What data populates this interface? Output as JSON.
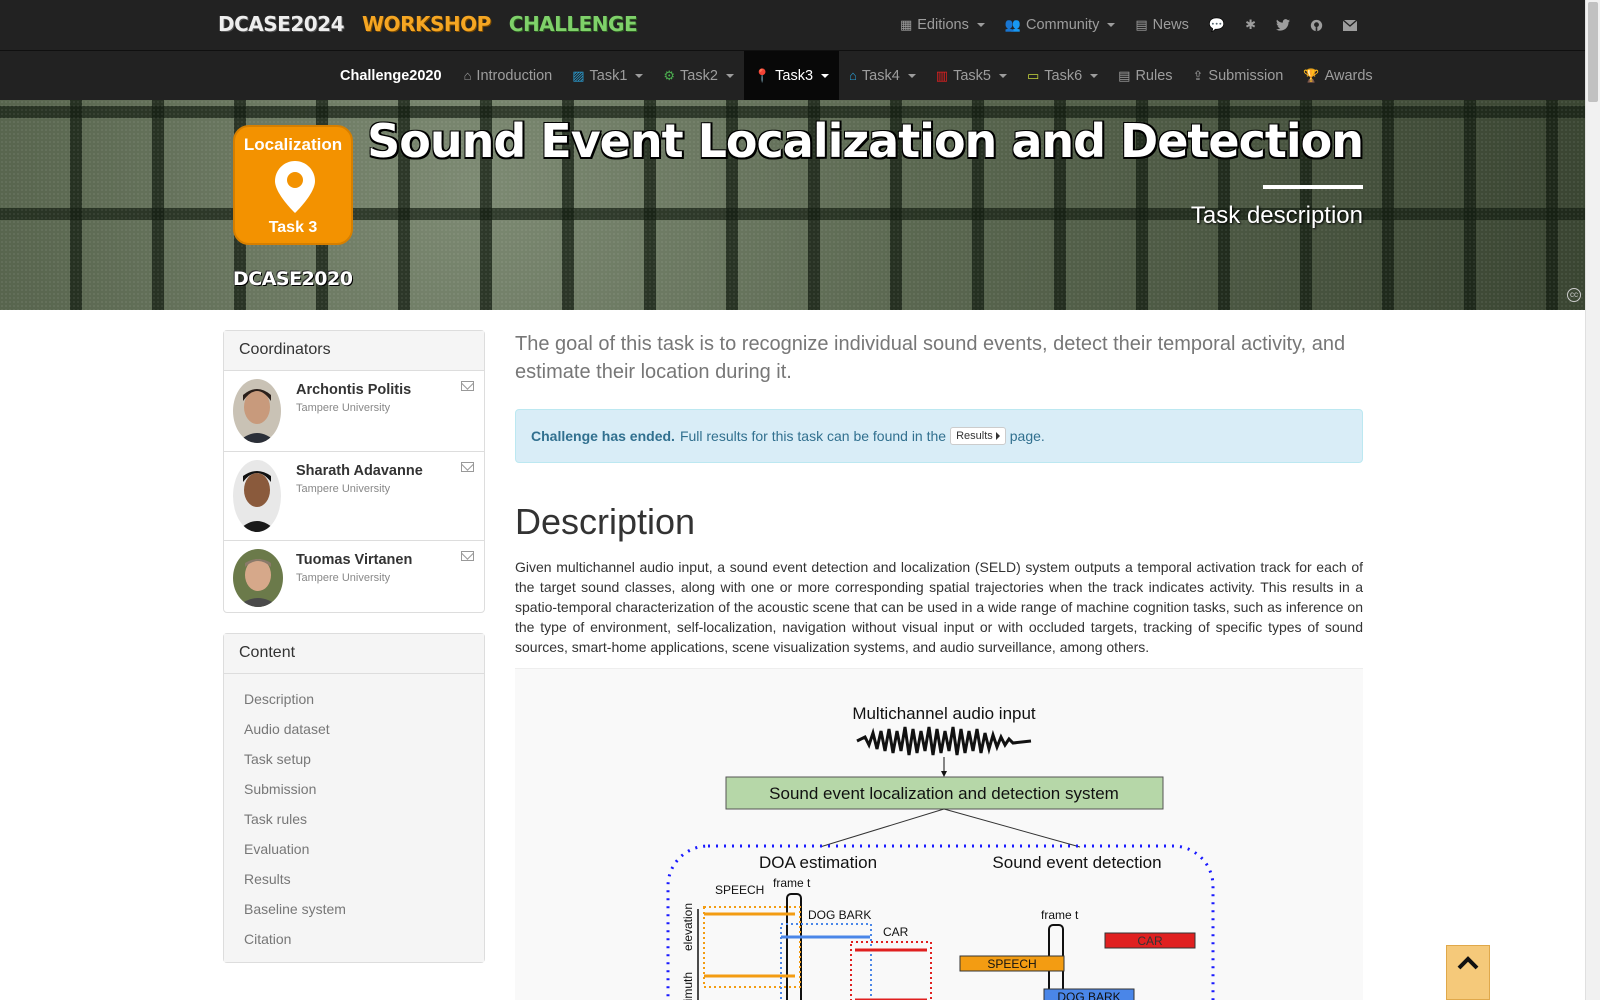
{
  "brand": {
    "dcase": "DCASE2024",
    "workshop": "WORKSHOP",
    "challenge": "CHALLENGE"
  },
  "top_nav": [
    {
      "label": "Editions",
      "icon": "calendar-icon",
      "dropdown": true
    },
    {
      "label": "Community",
      "icon": "users-icon",
      "dropdown": true
    },
    {
      "label": "News",
      "icon": "newspaper-icon",
      "dropdown": false
    },
    {
      "label": "",
      "icon": "comments-icon",
      "dropdown": false
    },
    {
      "label": "",
      "icon": "slack-icon",
      "dropdown": false
    },
    {
      "label": "",
      "icon": "twitter-icon",
      "dropdown": false
    },
    {
      "label": "",
      "icon": "github-icon",
      "dropdown": false
    },
    {
      "label": "",
      "icon": "envelope-icon",
      "dropdown": false
    }
  ],
  "sub_nav": {
    "brand": "Challenge2020",
    "items": [
      {
        "label": "Introduction",
        "icon": "home-icon",
        "dropdown": false
      },
      {
        "label": "Task1",
        "icon": "image-icon",
        "dropdown": true
      },
      {
        "label": "Task2",
        "icon": "cogs-icon",
        "dropdown": true
      },
      {
        "label": "Task3",
        "icon": "map-marker-icon",
        "dropdown": true,
        "active": true
      },
      {
        "label": "Task4",
        "icon": "home-icon",
        "dropdown": true
      },
      {
        "label": "Task5",
        "icon": "industry-icon",
        "dropdown": true
      },
      {
        "label": "Task6",
        "icon": "comment-icon",
        "dropdown": true
      },
      {
        "label": "Rules",
        "icon": "list-icon",
        "dropdown": false
      },
      {
        "label": "Submission",
        "icon": "upload-icon",
        "dropdown": false
      },
      {
        "label": "Awards",
        "icon": "trophy-icon",
        "dropdown": false
      }
    ]
  },
  "hero": {
    "badge_top": "Localization",
    "badge_bottom": "Task 3",
    "edition_logo": "DCASE2020",
    "title": "Sound Event Localization and Detection",
    "subtitle": "Task description"
  },
  "coordinators": {
    "heading": "Coordinators",
    "people": [
      {
        "name": "Archontis Politis",
        "affiliation": "Tampere University"
      },
      {
        "name": "Sharath Adavanne",
        "affiliation": "Tampere University"
      },
      {
        "name": "Tuomas Virtanen",
        "affiliation": "Tampere University"
      }
    ]
  },
  "content_panel": {
    "heading": "Content",
    "items": [
      "Description",
      "Audio dataset",
      "Task setup",
      "Submission",
      "Task rules",
      "Evaluation",
      "Results",
      "Baseline system",
      "Citation"
    ]
  },
  "main": {
    "lead": "The goal of this task is to recognize individual sound events, detect their temporal activity, and estimate their location during it.",
    "alert_strong": "Challenge has ended.",
    "alert_text": "Full results for this task can be found in the",
    "alert_button": "Results",
    "alert_tail": "page.",
    "description_heading": "Description",
    "description_text": "Given multichannel audio input, a sound event detection and localization (SELD) system outputs a temporal activation track for each of the target sound classes, along with one or more corresponding spatial trajectories when the track indicates activity. This results in a spatio-temporal characterization of the acoustic scene that can be used in a wide range of machine cognition tasks, such as inference on the type of environment, self-localization, navigation without visual input or with occluded targets, tracking of specific types of sound sources, smart-home applications, scene visualization systems, and audio surveillance, among others."
  },
  "figure": {
    "input_label": "Multichannel audio input",
    "system_label": "Sound event localization and detection system",
    "doa_label": "DOA estimation",
    "sed_label": "Sound event detection",
    "frame_label": "frame t",
    "elevation_label": "elevation",
    "azimuth_label": "azimuth",
    "classes": [
      "SPEECH",
      "DOG BARK",
      "CAR"
    ],
    "colors": {
      "speech": "#f39c12",
      "dog_bark": "#4a86e8",
      "car": "#e02020",
      "system_box": "#b6d7a8",
      "dashed": "#1a1aff"
    }
  }
}
